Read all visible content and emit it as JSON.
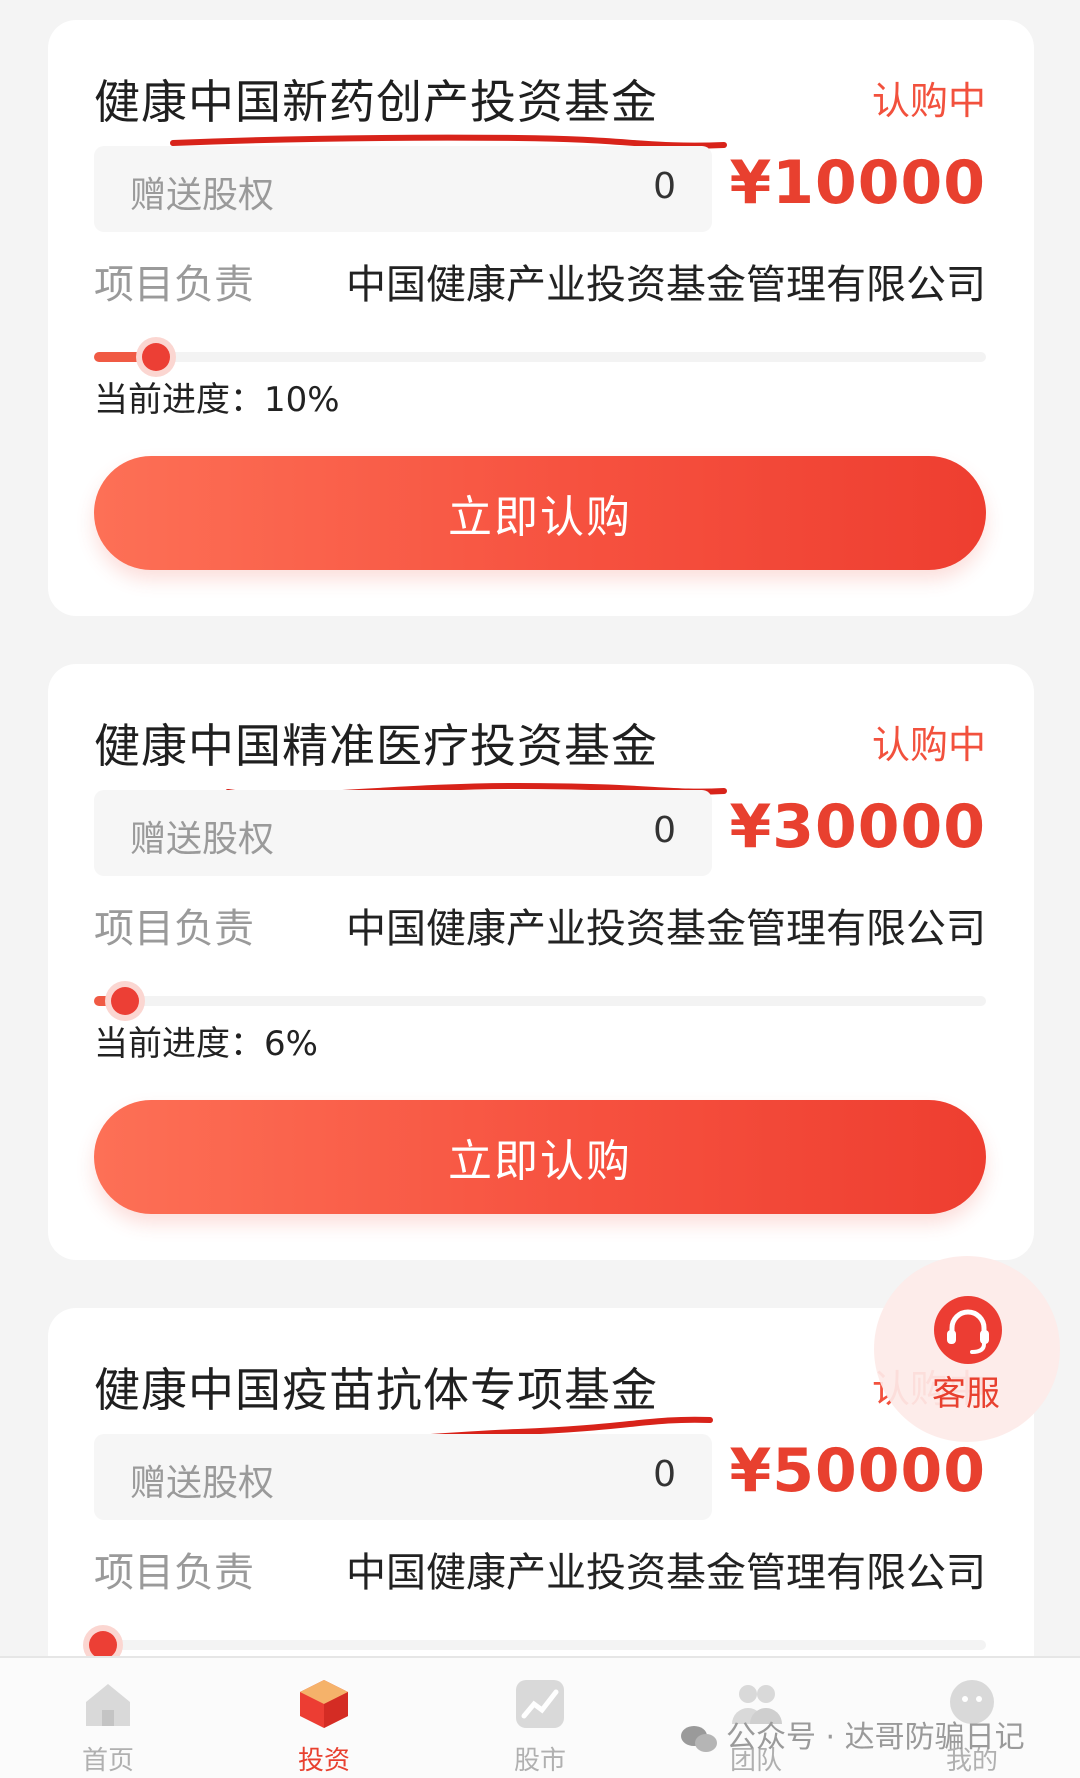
{
  "funds": [
    {
      "title": "健康中国新药创产投资基金",
      "status": "认购中",
      "gift_label": "赠送股权",
      "gift_value": "0",
      "price": "¥10000",
      "owner_label": "项目负责",
      "owner_value": "中国健康产业投资基金管理有限公司",
      "progress_label": "当前进度：10%",
      "progress_fraction": 0.07,
      "buy_label": "立即认购"
    },
    {
      "title": "健康中国精准医疗投资基金",
      "status": "认购中",
      "gift_label": "赠送股权",
      "gift_value": "0",
      "price": "¥30000",
      "owner_label": "项目负责",
      "owner_value": "中国健康产业投资基金管理有限公司",
      "progress_label": "当前进度：6%",
      "progress_fraction": 0.035,
      "buy_label": "立即认购"
    },
    {
      "title": "健康中国疫苗抗体专项基金",
      "status": "认购中",
      "gift_label": "赠送股权",
      "gift_value": "0",
      "price": "¥50000",
      "owner_label": "项目负责",
      "owner_value": "中国健康产业投资基金管理有限公司",
      "progress_fraction": 0.01
    }
  ],
  "customer_service": {
    "label": "客服",
    "icon": "headset-icon"
  },
  "tabbar": {
    "items": [
      {
        "label": "首页",
        "icon": "home-icon"
      },
      {
        "label": "投资",
        "icon": "invest-cube-icon"
      },
      {
        "label": "股市",
        "icon": "stock-chart-icon"
      },
      {
        "label": "团队",
        "icon": "team-icon"
      },
      {
        "label": "我的",
        "icon": "profile-icon"
      }
    ],
    "active_index": 1
  },
  "watermark": {
    "text": "公众号 · 达哥防骗日记"
  },
  "colors": {
    "accent": "#e8402f",
    "button_start": "#fd7056",
    "button_end": "#ee3e30",
    "hand_underline": "#d8231a"
  }
}
